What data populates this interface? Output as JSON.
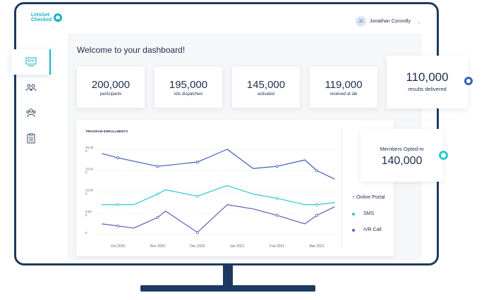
{
  "brand": {
    "name": "LetsGetChecked",
    "line1": "LetsGet",
    "line2": "Checked"
  },
  "user": {
    "initials": "JC",
    "name": "Jonathan Connolly"
  },
  "sidebar": {
    "items": [
      {
        "icon": "dashboard-icon"
      },
      {
        "icon": "users-icon"
      },
      {
        "icon": "groups-icon"
      },
      {
        "icon": "clipboard-icon"
      }
    ]
  },
  "welcome": "Welcome to your dashboard!",
  "stats": [
    {
      "value": "200,000",
      "label": "participants"
    },
    {
      "value": "195,000",
      "label": "kits dispatched"
    },
    {
      "value": "145,000",
      "label": "activated"
    },
    {
      "value": "119,000",
      "label": "recieved at lab"
    },
    {
      "value": "110,000",
      "label": "results delivered"
    }
  ],
  "opted_in": {
    "label": "Members Opted-in",
    "value": "140,000"
  },
  "colors": {
    "navy": "#1e3a5f",
    "teal": "#19b3c3",
    "online": "#3d5fb8",
    "sms": "#2ec9c9",
    "ivr": "#6a5bb7"
  },
  "chart_data": {
    "type": "line",
    "title": "PROGRAM ENROLLMENTS",
    "categories": [
      "Oct 2020",
      "Nov 2020",
      "Dec 2020",
      "Jan 2021",
      "Feb 2021",
      "Mar 2021"
    ],
    "yticks": [
      "20,00\n0",
      "15,00\n0",
      "10,00\n0",
      "5,00\n0",
      "0"
    ],
    "ylim": [
      0,
      20000
    ],
    "grid": true,
    "series": [
      {
        "name": "Online Portal",
        "marker": "+",
        "color": "#3d5fb8",
        "x": [
          -0.4,
          0,
          1,
          2,
          2.75,
          3.4,
          4,
          4.7,
          5,
          5.45
        ],
        "values": [
          19000,
          18000,
          16000,
          17000,
          20000,
          15500,
          16000,
          17500,
          15000,
          13000
        ]
      },
      {
        "name": "SMS",
        "marker": "dot",
        "color": "#2ec9c9",
        "x": [
          -0.4,
          0,
          0.4,
          1,
          1.2,
          2,
          2.75,
          3.4,
          4,
          4.7,
          5,
          5.45
        ],
        "values": [
          7000,
          7000,
          7000,
          9500,
          10500,
          9000,
          11500,
          9500,
          8500,
          7000,
          7000,
          7500
        ]
      },
      {
        "name": "IVR Call",
        "marker": "dot",
        "color": "#6a5bb7",
        "x": [
          -0.4,
          0,
          0.4,
          1,
          1.2,
          2,
          2.75,
          3.4,
          4,
          4.7,
          5,
          5.45
        ],
        "values": [
          2500,
          2000,
          1500,
          4000,
          5500,
          500,
          7000,
          6000,
          4500,
          2500,
          4500,
          6500
        ]
      }
    ]
  }
}
